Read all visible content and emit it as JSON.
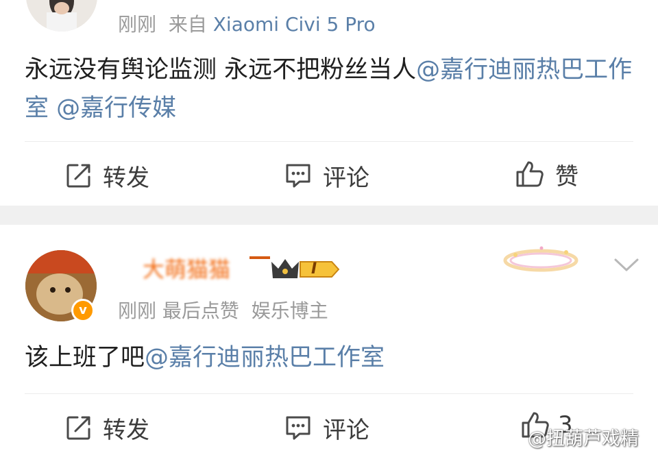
{
  "post1": {
    "time": "刚刚",
    "source_prefix": "来自",
    "source_device": "Xiaomi Civi 5 Pro",
    "text": "永远没有舆论监测  永远不把粉丝当人",
    "mentions": [
      "@嘉行迪丽热巴工作室",
      "@嘉行传媒"
    ],
    "actions": {
      "repost": "转发",
      "comment": "评论",
      "like": "赞"
    }
  },
  "post2": {
    "username": "大萌猫猫",
    "badge_level": "I",
    "time": "刚刚",
    "last_like": "最后点赞",
    "category": "娱乐博主",
    "text": "该上班了吧",
    "mention": "@嘉行迪丽热巴工作室",
    "actions": {
      "repost": "转发",
      "comment": "评论",
      "like_count": "3"
    }
  },
  "watermark": "@扭葫芦戏精",
  "colors": {
    "link": "#5a7fa8",
    "meta": "#9a9a9a",
    "username": "#f26a10",
    "separator": "#f0f0f0"
  }
}
